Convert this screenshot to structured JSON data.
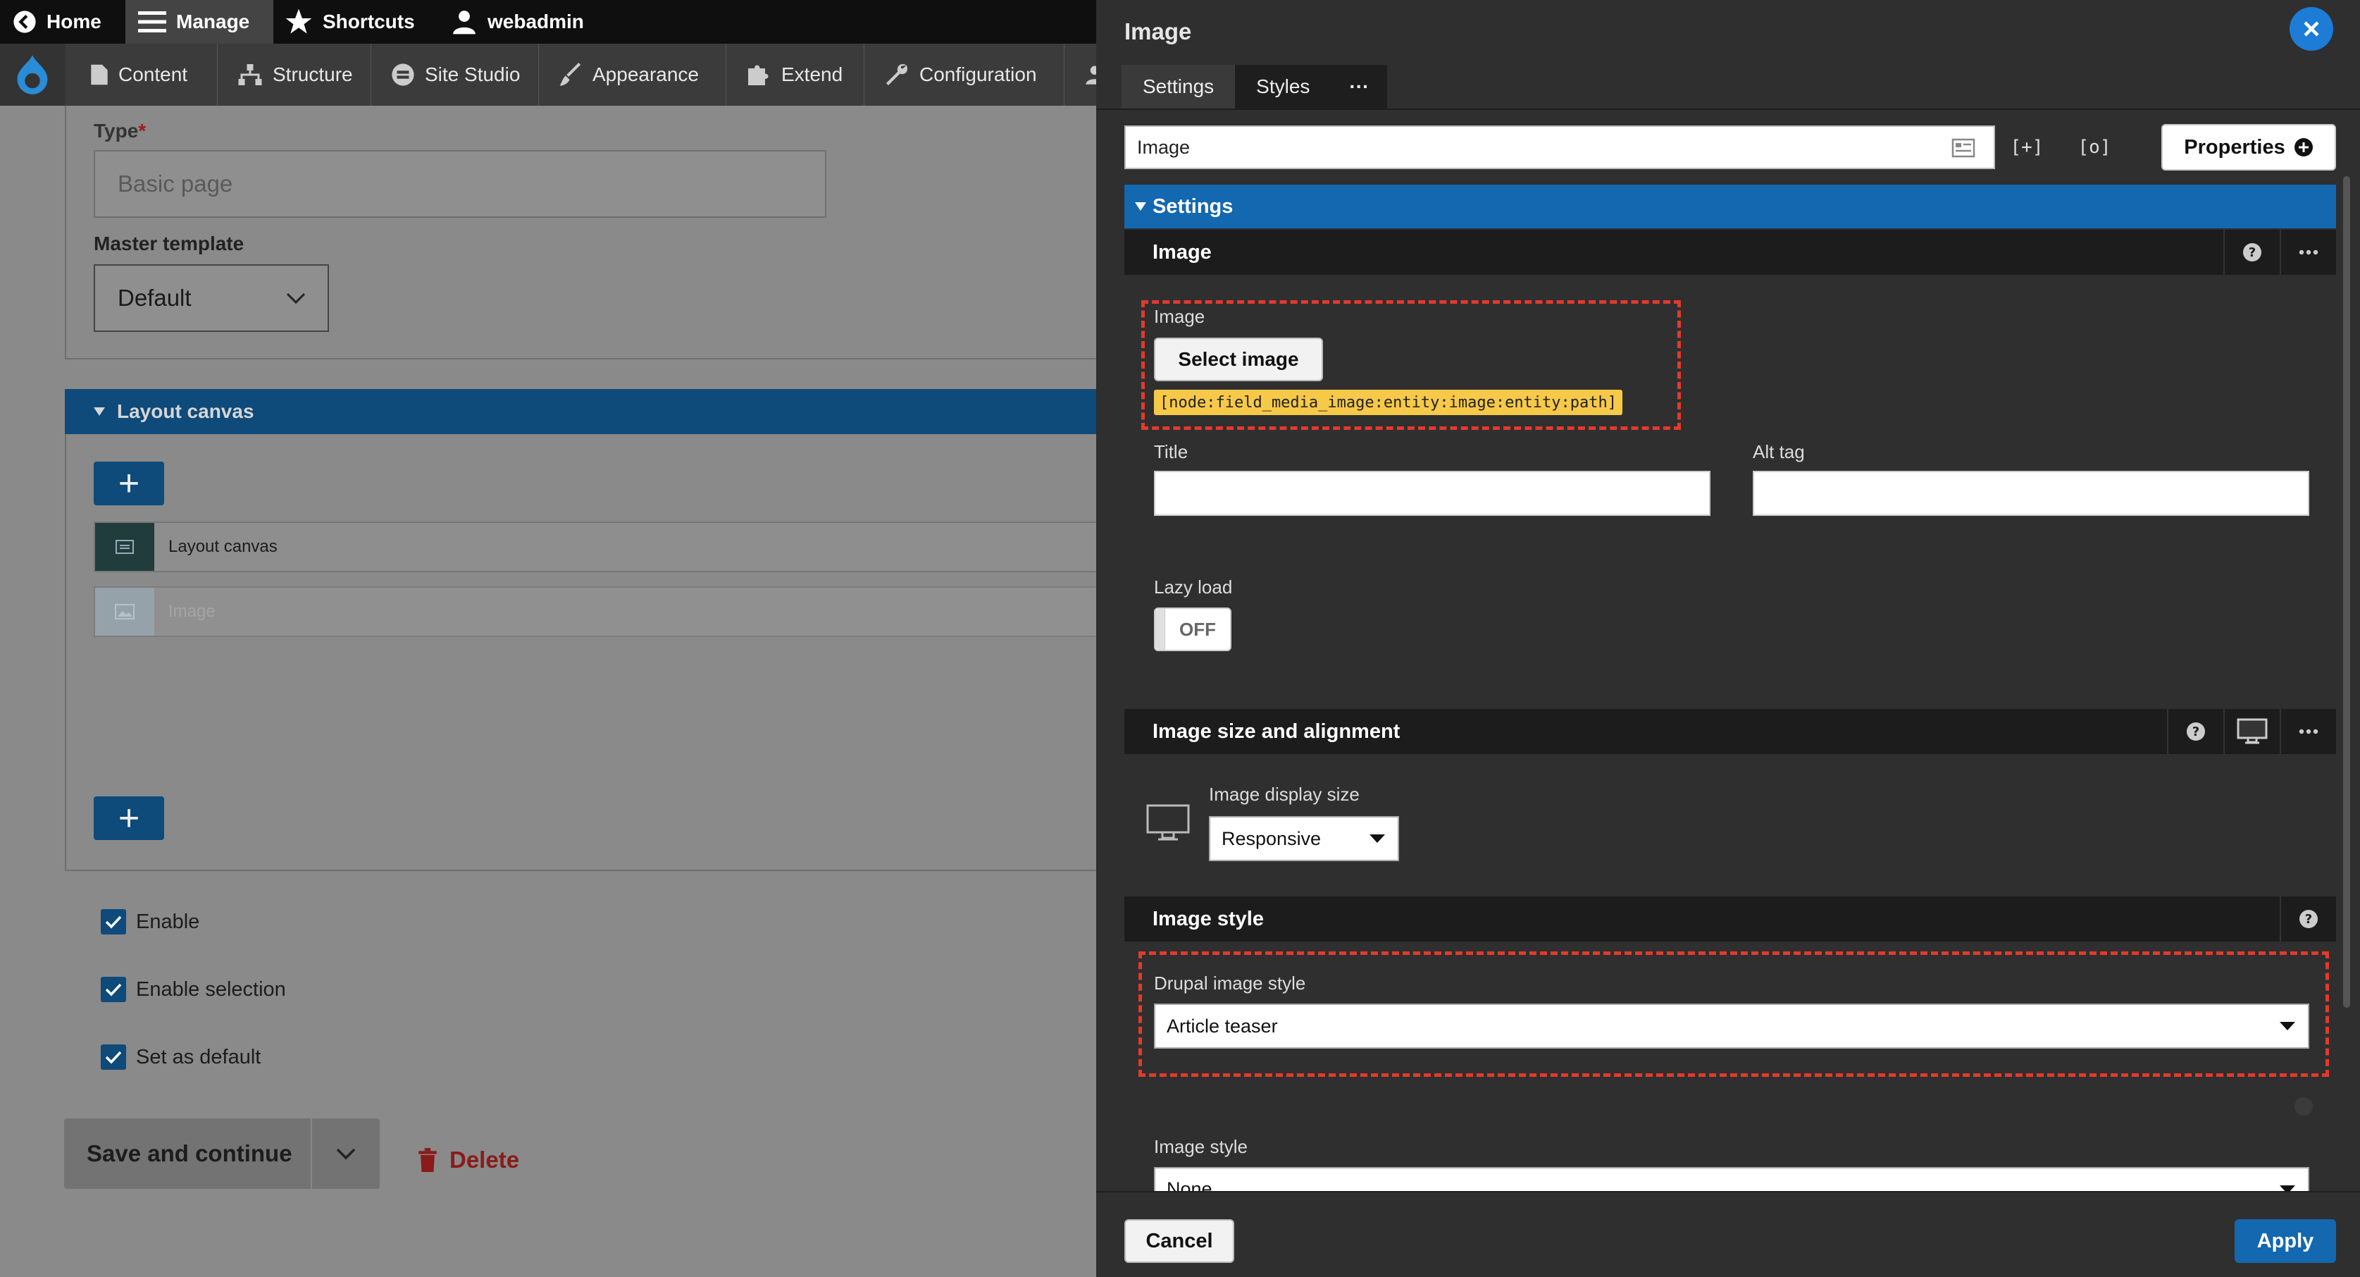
{
  "toolbar": {
    "home": "Home",
    "manage": "Manage",
    "shortcuts": "Shortcuts",
    "user": "webadmin"
  },
  "tray": {
    "content": "Content",
    "structure": "Structure",
    "site_studio": "Site Studio",
    "appearance": "Appearance",
    "extend": "Extend",
    "configuration": "Configuration"
  },
  "form": {
    "type_label": "Type",
    "type_required": "*",
    "type_value": "Basic page",
    "master_label": "Master template",
    "master_value": "Default",
    "canvas_heading": "Layout canvas",
    "canvas_row_label": "Layout canvas",
    "image_row_label": "Image",
    "checkboxes": [
      "Enable",
      "Enable selection",
      "Set as default"
    ],
    "save_label": "Save and continue",
    "delete_label": "Delete"
  },
  "panel": {
    "title": "Image",
    "tabs": [
      "Settings",
      "Styles",
      "···"
    ],
    "name_value": "Image",
    "properties_label": "Properties",
    "settings_bar": "Settings",
    "image_section": {
      "heading": "Image",
      "image_label": "Image",
      "select_button": "Select image",
      "token": "[node:field_media_image:entity:image:entity:path]",
      "title_label": "Title",
      "alt_label": "Alt tag",
      "lazy_label": "Lazy load",
      "lazy_value": "OFF"
    },
    "size_section": {
      "heading": "Image size and alignment",
      "display_size_label": "Image display size",
      "display_size_value": "Responsive"
    },
    "style_section": {
      "heading": "Image style",
      "drupal_label": "Drupal image style",
      "drupal_value": "Article teaser",
      "image_style_label": "Image style",
      "image_style_value": "None"
    },
    "cancel_label": "Cancel",
    "apply_label": "Apply"
  },
  "colors": {
    "accent": "#1368b0",
    "highlight_dash": "#e23a2c",
    "token_bg": "#f7c948"
  }
}
